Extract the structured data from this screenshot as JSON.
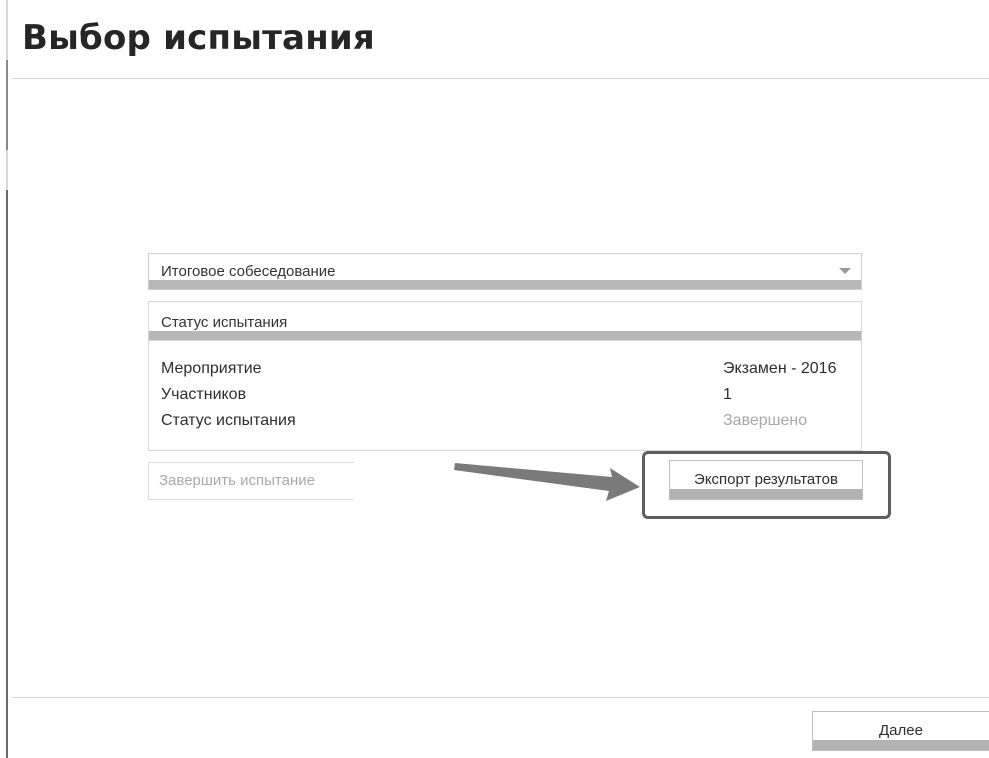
{
  "page": {
    "title": "Выбор испытания"
  },
  "test_select": {
    "selected": "Итоговое собеседование",
    "icon": "chevron-down-icon"
  },
  "status_panel": {
    "header": "Статус испытания",
    "rows": [
      {
        "label": "Мероприятие",
        "value": "Экзамен - 2016"
      },
      {
        "label": "Участников",
        "value": "1"
      },
      {
        "label": "Статус испытания",
        "value": "Завершено"
      }
    ]
  },
  "actions": {
    "finish_label": "Завершить испытание",
    "export_label": "Экспорт результатов"
  },
  "footer": {
    "next_label": "Далее"
  },
  "colors": {
    "title": "#262626",
    "muted_text": "#a8a8a8",
    "highlight_border": "#5e5e5e",
    "arrow": "#7a7a7a"
  }
}
